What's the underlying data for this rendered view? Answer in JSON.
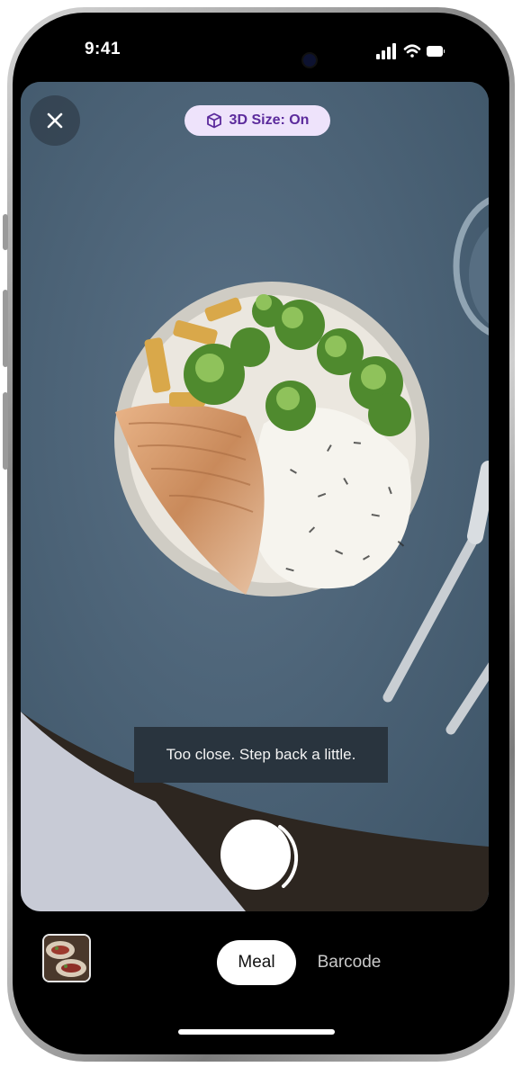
{
  "status_bar": {
    "time": "9:41"
  },
  "camera": {
    "size_toggle": {
      "label": "3D Size: On",
      "icon": "cube-icon",
      "accent": "#5b2a9c",
      "background": "#eee3fb"
    },
    "close_icon": "close-icon",
    "hint": "Too close. Step back a little."
  },
  "bottom_bar": {
    "modes": [
      {
        "label": "Meal",
        "selected": true
      },
      {
        "label": "Barcode",
        "selected": false
      }
    ]
  }
}
